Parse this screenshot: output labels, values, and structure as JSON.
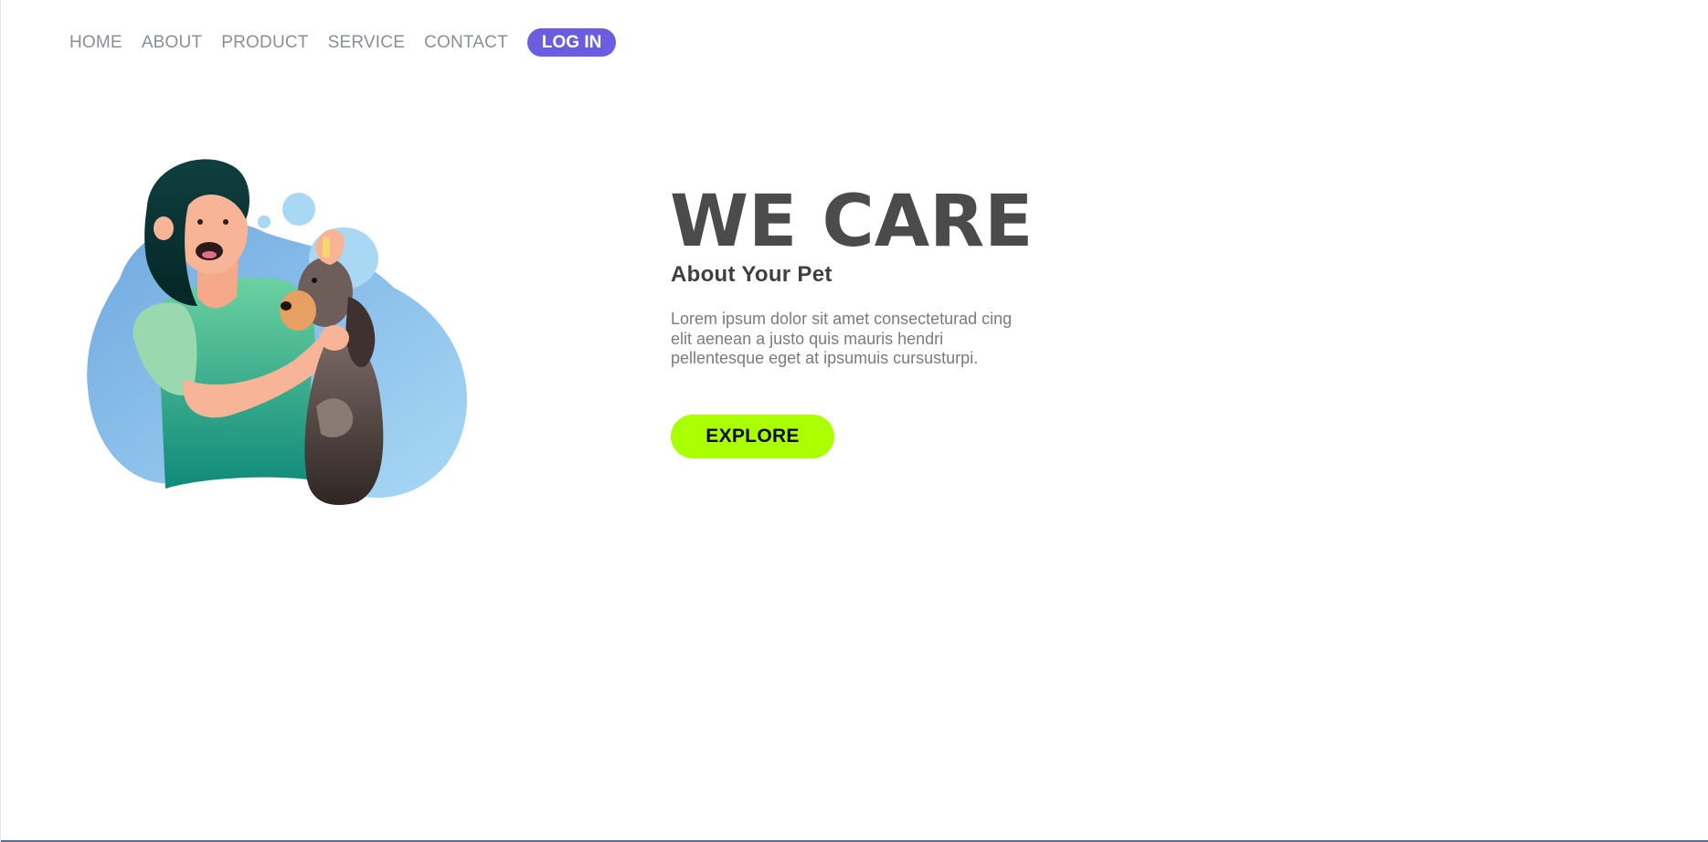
{
  "nav": {
    "items": [
      "HOME",
      "ABOUT",
      "PRODUCT",
      "SERVICE",
      "CONTACT"
    ],
    "login_label": "LOG IN"
  },
  "hero": {
    "title": "WE CARE",
    "subtitle": "About Your Pet",
    "body": "Lorem ipsum dolor sit amet consecteturad cing elit aenean a justo quis mauris hendri pellentesque eget at ipsumuis cursusturpi.",
    "cta_label": "EXPLORE"
  },
  "colors": {
    "accent": "#6a5ddf",
    "cta": "#aaff00",
    "title": "#4b4b4b",
    "nav_text": "#8a8f96",
    "illustration_blob": "#8fc6ee"
  }
}
